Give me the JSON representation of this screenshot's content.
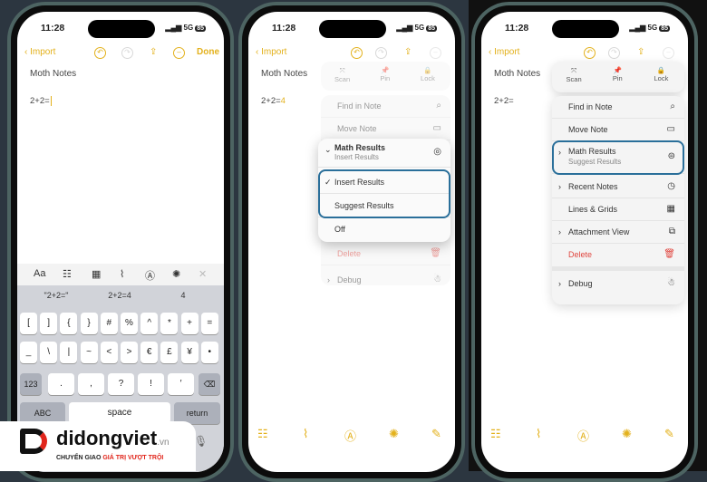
{
  "status": {
    "time": "11:28",
    "network": "5G",
    "battery": "85"
  },
  "nav": {
    "back": "Import",
    "done": "Done"
  },
  "note": {
    "title": "Moth Notes",
    "eq1": "2+2=",
    "eq2": "2+2=",
    "eq2_result": "4",
    "eq3": "2+2="
  },
  "format_bar": {
    "text_style": "Aa"
  },
  "suggestions": [
    "\"2+2=\"",
    "2+2=4",
    "4"
  ],
  "keys": {
    "row1": [
      "[",
      "]",
      "{",
      "}",
      "#",
      "%",
      "^",
      "*",
      "+",
      "="
    ],
    "row2": [
      "_",
      "\\",
      "|",
      "~",
      "<",
      ">",
      "€",
      "£",
      "¥",
      "•"
    ],
    "row3": [
      ".",
      ",",
      "?",
      "!",
      "′"
    ],
    "num": "123",
    "abc": "ABC",
    "space": "space",
    "return": "return"
  },
  "quick_actions": [
    {
      "label": "Scan",
      "icon": "⤧"
    },
    {
      "label": "Pin",
      "icon": "📌"
    },
    {
      "label": "Lock",
      "icon": "🔒"
    }
  ],
  "menu2": {
    "find": "Find in Note",
    "move": "Move Note",
    "math": "Math Results",
    "math_sub": "Insert Results",
    "opt_insert": "Insert Results",
    "opt_suggest": "Suggest Results",
    "opt_off": "Off",
    "delete": "Delete",
    "debug": "Debug"
  },
  "menu3": {
    "find": "Find in Note",
    "move": "Move Note",
    "math": "Math Results",
    "math_sub": "Suggest Results",
    "recent": "Recent Notes",
    "lines": "Lines & Grids",
    "attach": "Attachment View",
    "delete": "Delete",
    "debug": "Debug"
  },
  "logo": {
    "brand": "didongviet",
    "tld": ".vn",
    "tagline_a": "CHUYỂN GIAO",
    "tagline_b": "GIÁ TRỊ VƯỢT TRỘI"
  },
  "colors": {
    "accent": "#e3b11c",
    "highlight": "#2a6f9a",
    "delete": "#e0463f",
    "brand_red": "#e1251b"
  }
}
